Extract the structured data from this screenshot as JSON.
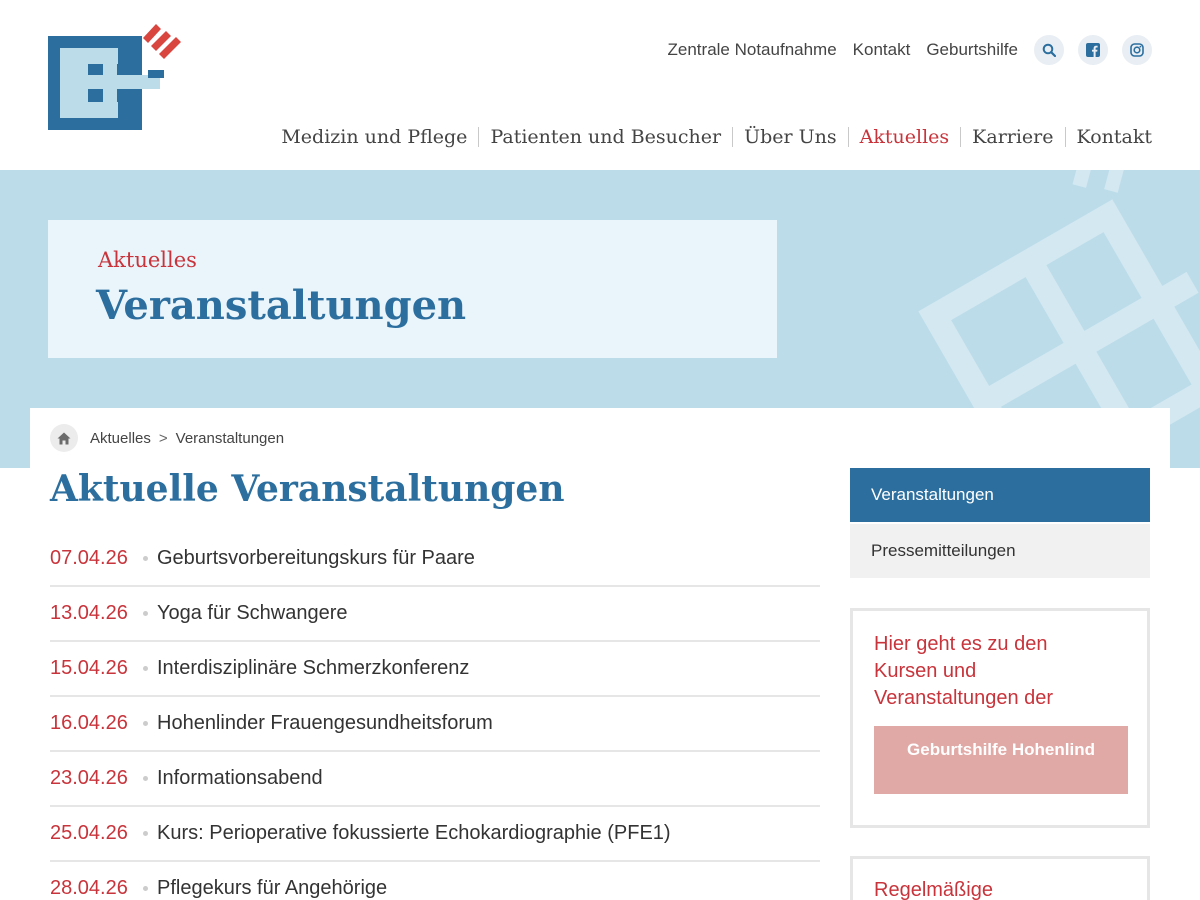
{
  "brand": {
    "primary": "#2c6f9f",
    "accent": "#c8343b",
    "hero_bg": "#bcdcea",
    "logo_alt": "E+ logo"
  },
  "topnav": {
    "links": [
      "Zentrale Notaufnahme",
      "Kontakt",
      "Geburtshilfe"
    ],
    "icons": [
      "search-icon",
      "facebook-icon",
      "instagram-icon"
    ]
  },
  "mainnav": {
    "items": [
      "Medizin und Pflege",
      "Patienten und Besucher",
      "Über Uns",
      "Aktuelles",
      "Karriere",
      "Kontakt"
    ],
    "active": "Aktuelles"
  },
  "hero": {
    "kicker": "Aktuelles",
    "title": "Veranstaltungen"
  },
  "breadcrumb": {
    "items": [
      "Aktuelles",
      "Veranstaltungen"
    ],
    "separator": ">"
  },
  "page_title": "Aktuelle Veranstaltungen",
  "events": [
    {
      "date": "07.04.26",
      "title": "Geburtsvorbereitungskurs für Paare"
    },
    {
      "date": "13.04.26",
      "title": "Yoga für Schwangere"
    },
    {
      "date": "15.04.26",
      "title": "Interdisziplinäre Schmerzkonferenz"
    },
    {
      "date": "16.04.26",
      "title": "Hohenlinder Frauengesundheitsforum"
    },
    {
      "date": "23.04.26",
      "title": "Informationsabend"
    },
    {
      "date": "25.04.26",
      "title": "Kurs: Perioperative fokussierte Echokardiographie (PFE1)"
    },
    {
      "date": "28.04.26",
      "title": "Pflegekurs für Angehörige"
    }
  ],
  "sidebar": {
    "nav": [
      {
        "label": "Veranstaltungen",
        "active": true
      },
      {
        "label": "Pressemitteilungen",
        "active": false
      }
    ],
    "promo": {
      "text": "Hier geht es zu den Kursen und Veranstaltungen der",
      "button": "Geburtshilfe Hohenlind"
    },
    "promo2": {
      "text": "Regelmäßige"
    }
  }
}
